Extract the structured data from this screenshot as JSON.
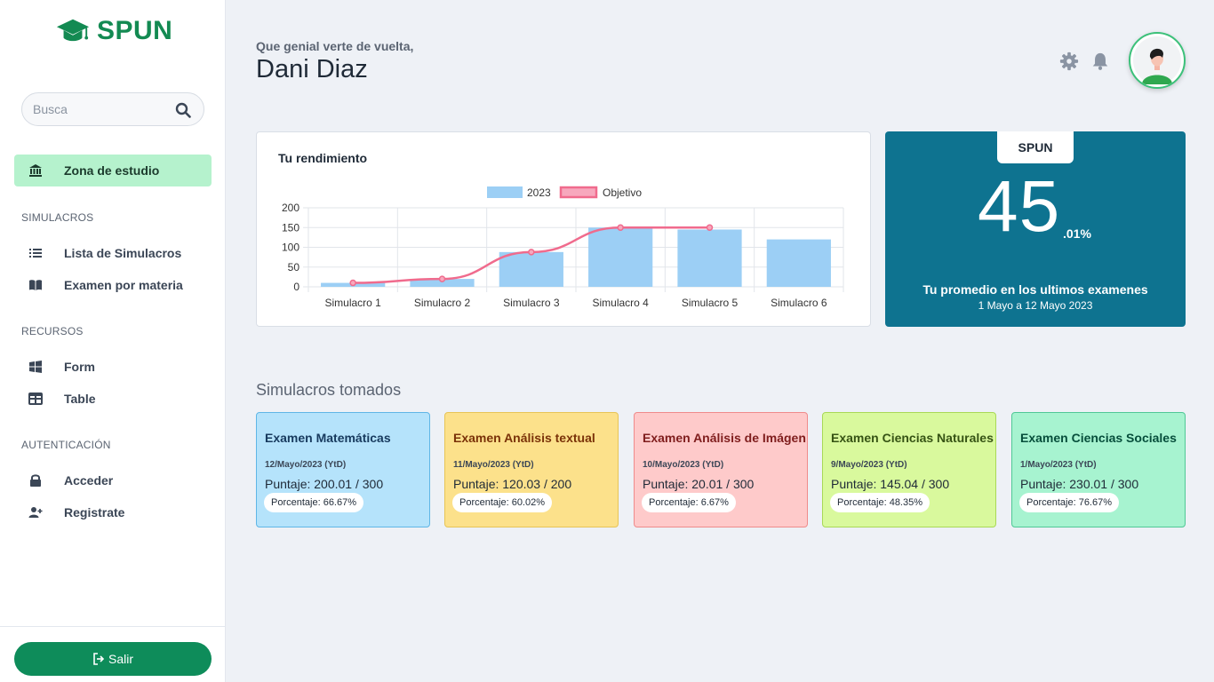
{
  "app": {
    "name": "SPUN"
  },
  "sidebar": {
    "search_placeholder": "Busca",
    "active_item": "Zona de estudio",
    "sections": [
      {
        "title": "SIMULACROS",
        "items": [
          "Lista de Simulacros",
          "Examen por materia"
        ]
      },
      {
        "title": "RECURSOS",
        "items": [
          "Form",
          "Table"
        ]
      },
      {
        "title": "AUTENTICACIÓN",
        "items": [
          "Acceder",
          "Registrate"
        ]
      }
    ],
    "logout_label": "Salir"
  },
  "header": {
    "greeting": "Que genial verte de vuelta,",
    "username": "Dani Diaz"
  },
  "performance": {
    "title": "Tu rendimiento",
    "chart_data": {
      "type": "bar",
      "categories": [
        "Simulacro 1",
        "Simulacro 2",
        "Simulacro 3",
        "Simulacro 4",
        "Simulacro 5",
        "Simulacro 6"
      ],
      "series": [
        {
          "name": "2023",
          "type": "bar",
          "values": [
            10,
            20,
            88,
            150,
            145,
            120
          ],
          "color": "#9ccff5"
        },
        {
          "name": "Objetivo",
          "type": "line",
          "values": [
            10,
            20,
            88,
            150,
            150,
            null
          ],
          "color": "#f06b8d"
        }
      ],
      "yticks": [
        0,
        50,
        100,
        150,
        200
      ],
      "ylim": [
        0,
        200
      ],
      "legend": "top",
      "grid": true
    }
  },
  "score": {
    "tab": "SPUN",
    "value": "45",
    "decimal": ".01%",
    "caption": "Tu promedio en los ultimos examenes",
    "range": "1 Mayo a 12 Mayo 2023"
  },
  "taken": {
    "title": "Simulacros tomados",
    "exams": [
      {
        "name": "Examen Matemáticas",
        "date": "12/Mayo/2023 (YtD)",
        "score": "Puntaje: 200.01 / 300",
        "percent": "Porcentaje: 66.67%",
        "bg": "#b5e3fb",
        "border": "#5fb6e6",
        "title_color": "#173a5e"
      },
      {
        "name": "Examen Análisis textual",
        "date": "11/Mayo/2023 (YtD)",
        "score": "Puntaje: 120.03 / 200",
        "percent": "Porcentaje: 60.02%",
        "bg": "#fce18b",
        "border": "#e7c457",
        "title_color": "#7a3208"
      },
      {
        "name": "Examen Análisis de Imágen",
        "date": "10/Mayo/2023 (YtD)",
        "score": "Puntaje: 20.01 / 300",
        "percent": "Porcentaje: 6.67%",
        "bg": "#fecaca",
        "border": "#ef8b8b",
        "title_color": "#7f1d1d"
      },
      {
        "name": "Examen Ciencias Naturales",
        "date": "9/Mayo/2023 (YtD)",
        "score": "Puntaje: 145.04 / 300",
        "percent": "Porcentaje: 48.35%",
        "bg": "#d9f99d",
        "border": "#a9d957",
        "title_color": "#365314"
      },
      {
        "name": "Examen Ciencias Sociales",
        "date": "1/Mayo/2023 (YtD)",
        "score": "Puntaje: 230.01 / 300",
        "percent": "Porcentaje: 76.67%",
        "bg": "#a7f3d0",
        "border": "#50c896",
        "title_color": "#064e3b"
      }
    ]
  }
}
